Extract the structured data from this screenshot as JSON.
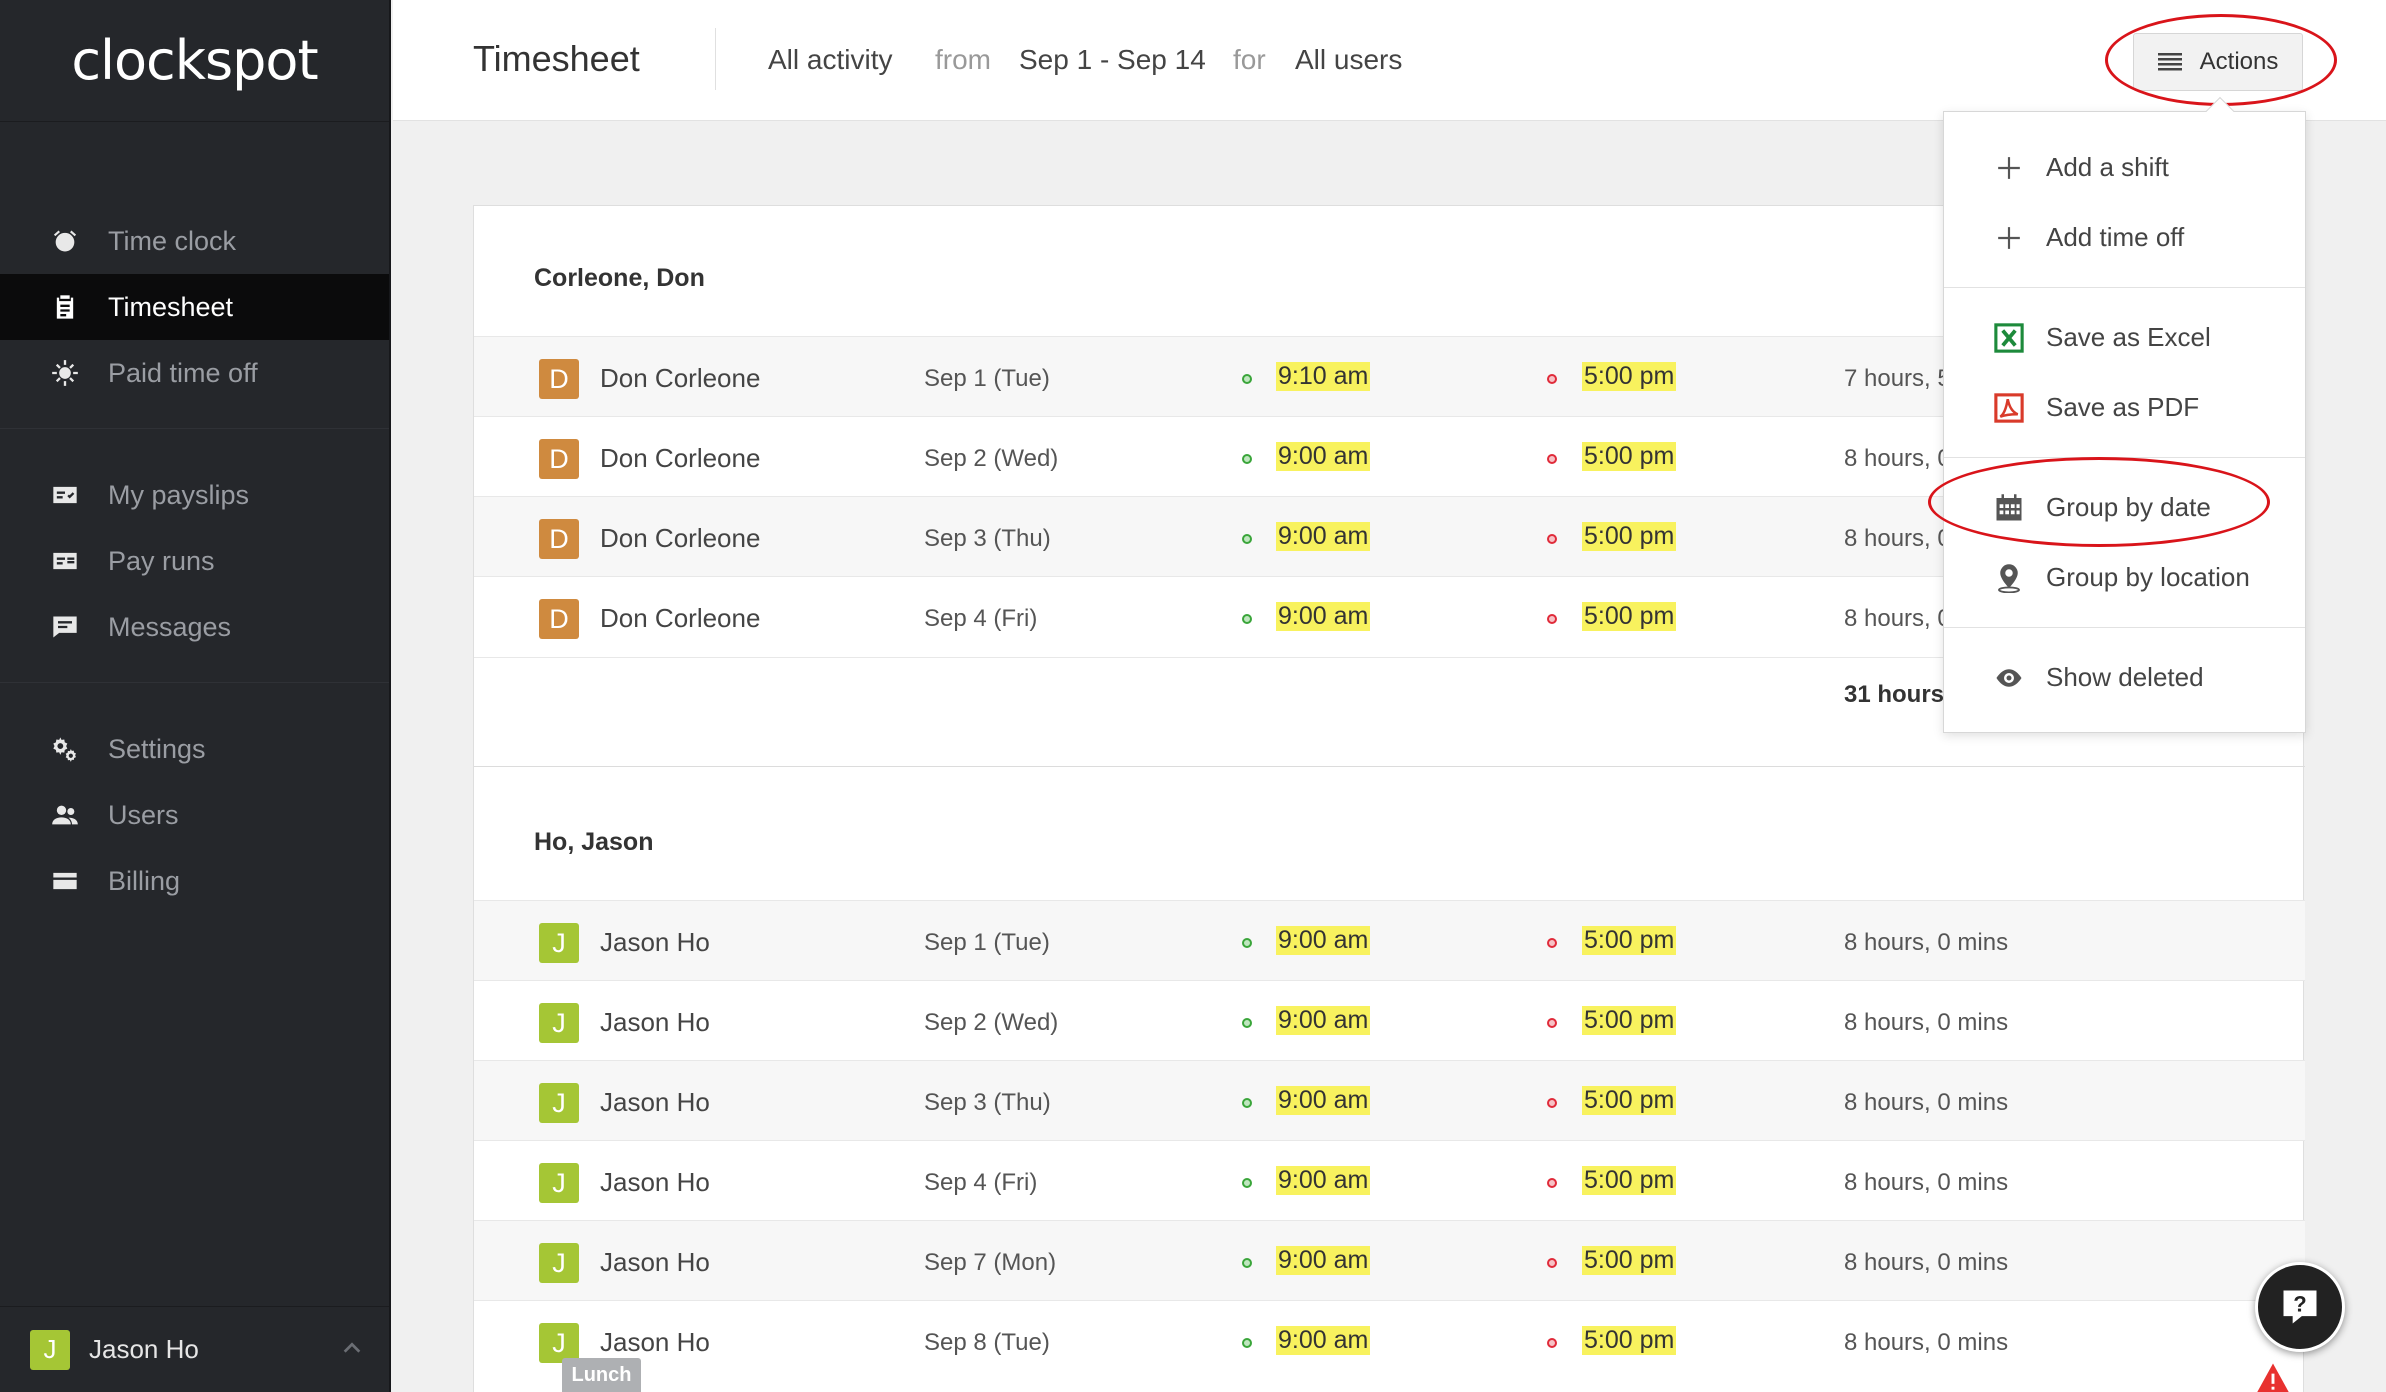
{
  "brand": {
    "logo": "clockspot",
    "accent_green": "#a5c635",
    "accent_orange": "#cf8a3f",
    "highlight_yellow": "#f8f25e",
    "annotation_red": "#d9141a"
  },
  "sidebar": {
    "items": [
      {
        "label": "Time clock",
        "icon": "alarm-clock-icon"
      },
      {
        "label": "Timesheet",
        "icon": "clipboard-icon",
        "active": true
      },
      {
        "label": "Paid time off",
        "icon": "sun-icon"
      },
      {
        "label": "My payslips",
        "icon": "payslip-icon"
      },
      {
        "label": "Pay runs",
        "icon": "pay-run-icon"
      },
      {
        "label": "Messages",
        "icon": "speech-bubble-icon"
      },
      {
        "label": "Settings",
        "icon": "gears-icon"
      },
      {
        "label": "Users",
        "icon": "users-icon"
      },
      {
        "label": "Billing",
        "icon": "credit-card-icon"
      }
    ],
    "user": {
      "initial": "J",
      "name": "Jason Ho"
    }
  },
  "header": {
    "title": "Timesheet",
    "activity": "All activity",
    "from_label": "from",
    "range": "Sep 1 - Sep 14",
    "for_label": "for",
    "users": "All users",
    "actions_label": "Actions"
  },
  "dropdown": {
    "items": [
      {
        "label": "Add a shift",
        "icon": "plus-icon"
      },
      {
        "label": "Add time off",
        "icon": "plus-icon"
      },
      {
        "label": "Save as Excel",
        "icon": "excel-icon"
      },
      {
        "label": "Save as PDF",
        "icon": "pdf-icon"
      },
      {
        "label": "Group by date",
        "icon": "calendar-icon"
      },
      {
        "label": "Group by location",
        "icon": "location-pin-icon"
      },
      {
        "label": "Show deleted",
        "icon": "eye-icon"
      }
    ]
  },
  "groups": [
    {
      "heading": "Corleone, Don",
      "rows": [
        {
          "initial": "D",
          "name": "Don Corleone",
          "date": "Sep 1 (Tue)",
          "in": "9:10  am",
          "out": "5:00  pm",
          "hours": "7 hours, 5"
        },
        {
          "initial": "D",
          "name": "Don Corleone",
          "date": "Sep 2 (Wed)",
          "in": "9:00  am",
          "out": "5:00  pm",
          "hours": "8 hours, 0"
        },
        {
          "initial": "D",
          "name": "Don Corleone",
          "date": "Sep 3 (Thu)",
          "in": "9:00  am",
          "out": "5:00  pm",
          "hours": "8 hours, 0"
        },
        {
          "initial": "D",
          "name": "Don Corleone",
          "date": "Sep 4 (Fri)",
          "in": "9:00  am",
          "out": "5:00  pm",
          "hours": "8 hours, 0"
        }
      ],
      "total": "31 hours,"
    },
    {
      "heading": "Ho, Jason",
      "rows": [
        {
          "initial": "J",
          "name": "Jason Ho",
          "date": "Sep 1 (Tue)",
          "in": "9:00  am",
          "out": "5:00  pm",
          "hours": "8 hours, 0 mins"
        },
        {
          "initial": "J",
          "name": "Jason Ho",
          "date": "Sep 2 (Wed)",
          "in": "9:00  am",
          "out": "5:00  pm",
          "hours": "8 hours, 0 mins"
        },
        {
          "initial": "J",
          "name": "Jason Ho",
          "date": "Sep 3 (Thu)",
          "in": "9:00  am",
          "out": "5:00  pm",
          "hours": "8 hours, 0 mins"
        },
        {
          "initial": "J",
          "name": "Jason Ho",
          "date": "Sep 4 (Fri)",
          "in": "9:00  am",
          "out": "5:00  pm",
          "hours": "8 hours, 0 mins"
        },
        {
          "initial": "J",
          "name": "Jason Ho",
          "date": "Sep 7 (Mon)",
          "in": "9:00  am",
          "out": "5:00  pm",
          "hours": "8 hours, 0 mins"
        },
        {
          "initial": "J",
          "name": "Jason Ho",
          "date": "Sep 8 (Tue)",
          "in": "9:00  am",
          "out": "5:00  pm",
          "hours": "8 hours, 0 mins"
        }
      ]
    }
  ],
  "badges": {
    "lunch": "Lunch"
  },
  "help": {
    "glyph": "?"
  }
}
